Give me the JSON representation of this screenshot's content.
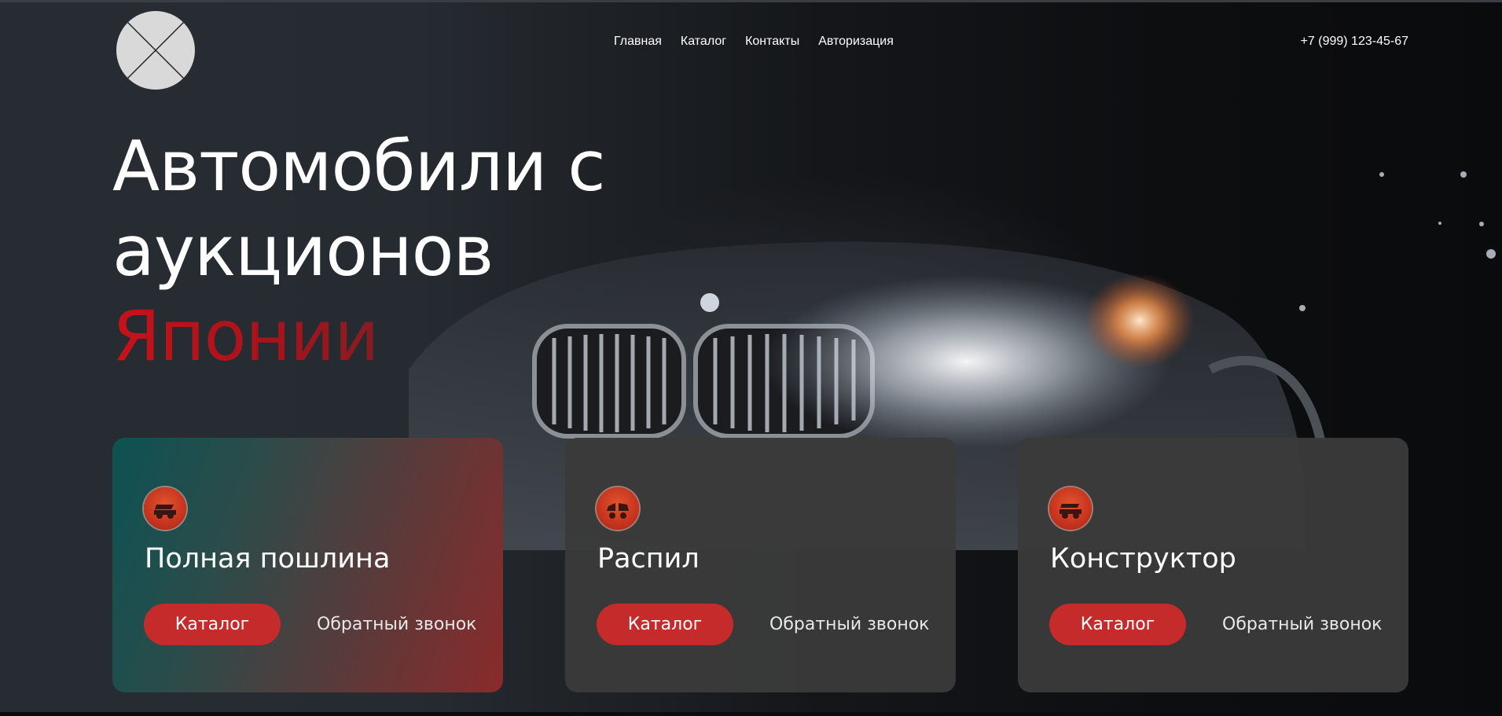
{
  "header": {
    "nav": [
      {
        "label": "Главная"
      },
      {
        "label": "Каталог"
      },
      {
        "label": "Контакты"
      },
      {
        "label": "Авторизация"
      }
    ],
    "phone": "+7 (999) 123-45-67"
  },
  "hero": {
    "line1": "Автомобили с",
    "line2": "аукционов",
    "accent": "Японии"
  },
  "cards": [
    {
      "title": "Полная пошлина",
      "button": "Каталог",
      "link": "Обратный звонок",
      "icon": "car-icon"
    },
    {
      "title": "Распил",
      "button": "Каталог",
      "link": "Обратный звонок",
      "icon": "car-parts-icon"
    },
    {
      "title": "Конструктор",
      "button": "Каталог",
      "link": "Обратный звонок",
      "icon": "car-icon"
    }
  ],
  "colors": {
    "accent": "#c52b2b",
    "card": "#3a3a3a",
    "background": "#1e2227"
  }
}
